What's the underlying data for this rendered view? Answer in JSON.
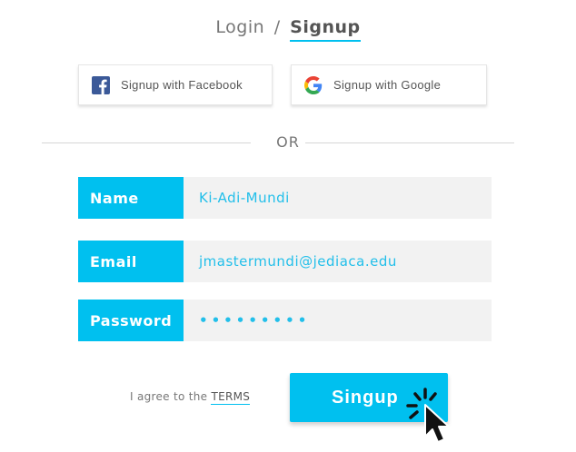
{
  "tabs": {
    "login": "Login",
    "separator": "/",
    "signup": "Signup",
    "active": "Signup"
  },
  "social": {
    "facebook_label": "Signup with Facebook",
    "facebook_icon": "facebook-icon",
    "google_label": "Signup with Google",
    "google_icon": "google-icon"
  },
  "divider": {
    "text": "OR"
  },
  "form": {
    "name": {
      "label": "Name",
      "value": "Ki-Adi-Mundi"
    },
    "email": {
      "label": "Email",
      "value": "jmastermundi@jediaca.edu"
    },
    "password": {
      "label": "Password",
      "value": "•••••••••"
    }
  },
  "terms": {
    "prefix": "I agree to the",
    "link": "TERMS"
  },
  "submit": {
    "label": "Singup"
  },
  "cursor": {
    "icon": "click-cursor-icon"
  },
  "colors": {
    "accent": "#00c0ef",
    "field_background": "#f2f2f2",
    "text": "#555555",
    "facebook": "#3b5998"
  }
}
